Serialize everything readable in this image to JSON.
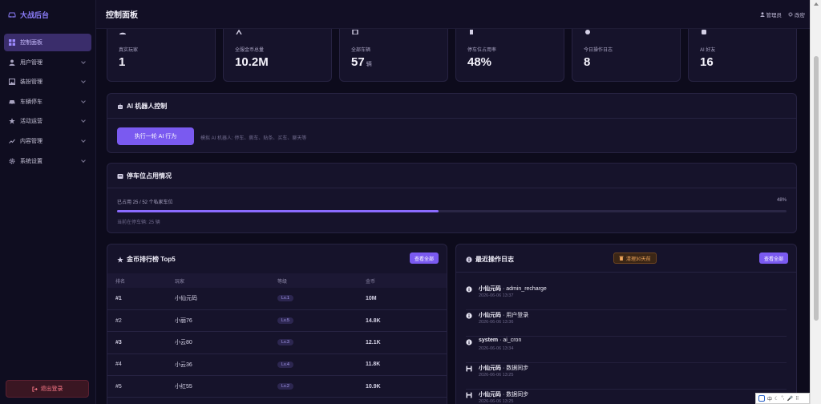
{
  "brand": {
    "name": "大战后台"
  },
  "sidebar": {
    "items": [
      {
        "label": "控制面板",
        "icon": "dashboard-icon",
        "active": true
      },
      {
        "label": "用户管理",
        "icon": "user-icon"
      },
      {
        "label": "装扮管理",
        "icon": "image-icon"
      },
      {
        "label": "车辆停车",
        "icon": "car-icon"
      },
      {
        "label": "活动运营",
        "icon": "star-icon"
      },
      {
        "label": "内容管理",
        "icon": "chart-line-icon"
      },
      {
        "label": "系统设置",
        "icon": "gear-icon"
      }
    ],
    "logout_label": "退出登录"
  },
  "header": {
    "title": "控制面板",
    "admin_label": "管理员",
    "settings_label": "改密"
  },
  "stats": [
    {
      "label": "真实玩家",
      "value": "1",
      "unit": ""
    },
    {
      "label": "全服金币总量",
      "value": "10.2M",
      "unit": ""
    },
    {
      "label": "全部车辆",
      "value": "57",
      "unit": "辆"
    },
    {
      "label": "停车位占用率",
      "value": "48%",
      "unit": ""
    },
    {
      "label": "今日操作日志",
      "value": "8",
      "unit": ""
    },
    {
      "label": "AI 好友",
      "value": "16",
      "unit": ""
    }
  ],
  "ai_control": {
    "title": "AI 机器人控制",
    "button_label": "执行一轮 AI 行为",
    "hint": "模拟 AI 机器人: 停车、撕车、贴条、买车、聊天等"
  },
  "parking": {
    "title": "停车位占用情况",
    "used_text": "已占用 25 / 52 个私家车位",
    "percent_text": "48%",
    "fill": 0.48,
    "current_text": "当前在停车辆: 25 辆"
  },
  "leaderboard": {
    "title": "金币排行榜 Top5",
    "view_all": "查看全部",
    "headers": [
      "排名",
      "玩家",
      "等级",
      "金币"
    ],
    "rows": [
      {
        "rank": "#1",
        "name": "小仙元码",
        "level": "Lv.1",
        "coins": "10M"
      },
      {
        "rank": "#2",
        "name": "小丽76",
        "level": "Lv.5",
        "coins": "14.8K"
      },
      {
        "rank": "#3",
        "name": "小云80",
        "level": "Lv.3",
        "coins": "12.1K"
      },
      {
        "rank": "#4",
        "name": "小云36",
        "level": "Lv.4",
        "coins": "11.8K"
      },
      {
        "rank": "#5",
        "name": "小红55",
        "level": "Lv.2",
        "coins": "10.9K"
      }
    ]
  },
  "logs": {
    "title": "最近操作日志",
    "clear_label": "清理30天前",
    "view_all": "查看全部",
    "items": [
      {
        "user": "小仙元码",
        "action": "admin_recharge",
        "time": "2026-06-06 13:37",
        "icon": "info-icon"
      },
      {
        "user": "小仙元码",
        "action": "用户登录",
        "time": "2026-06-06 13:36",
        "icon": "info-icon"
      },
      {
        "user": "system",
        "action": "ai_cron",
        "time": "2026-06-06 13:34",
        "icon": "info-icon"
      },
      {
        "user": "小仙元码",
        "action": "数据同步",
        "time": "2026-06-06 13:25",
        "icon": "save-icon"
      },
      {
        "user": "小仙元码",
        "action": "数据同步",
        "time": "2026-06-06 13:25",
        "icon": "save-icon"
      }
    ]
  },
  "ime": {
    "lang": "中"
  }
}
